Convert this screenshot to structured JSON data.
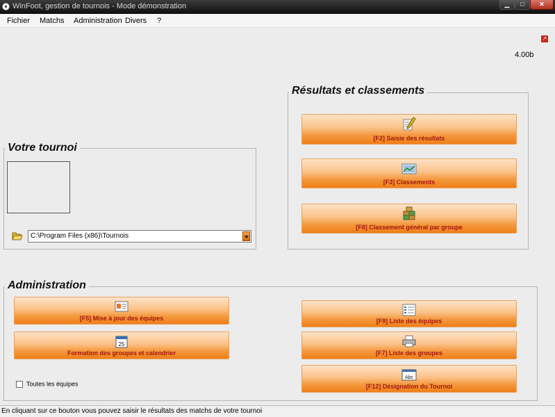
{
  "window": {
    "title": "WinFoot, gestion de tournois - Mode démonstration",
    "min_icon": "minimize-icon",
    "max_icon": "maximize-icon",
    "close_icon": "close-icon"
  },
  "menu": [
    {
      "label": "Fichier"
    },
    {
      "label": "Matchs"
    },
    {
      "label": "Administration"
    },
    {
      "label": "Divers"
    },
    {
      "label": "?"
    }
  ],
  "version": "4.00b",
  "results_section": {
    "title": "Résultats et classements",
    "buttons": [
      {
        "label": "[F2] Saisie des résultats",
        "icon": "edit-pencil-icon"
      },
      {
        "label": "[F3] Classements",
        "icon": "chart-image-icon"
      },
      {
        "label": "[F8] Classement général par groupe",
        "icon": "stacked-boxes-icon"
      }
    ]
  },
  "tournament_section": {
    "title": "Votre tournoi",
    "path": "C:\\Program Files (x86)\\Tournois"
  },
  "admin_section": {
    "title": "Administration",
    "buttons": [
      {
        "label": "[F5] Mise à jour des équipes",
        "icon": "team-card-icon"
      },
      {
        "label": "Formation des groupes et calendrier",
        "icon": "calendar-icon",
        "icon_text": "25"
      },
      {
        "label": "[F9] Liste des équipes",
        "icon": "list-icon"
      },
      {
        "label": "[F7] Liste des groupes",
        "icon": "printer-icon"
      },
      {
        "label": "[F12] Désignation du Tournoi",
        "icon": "abc-icon",
        "icon_text": "Abc"
      }
    ],
    "checkbox_label": "Toutes les équipes"
  },
  "status": "En cliquant sur ce bouton vous pouvez saisir le résultats des matchs de votre tournoi",
  "colors": {
    "button_gradient_start": "#fde3c8",
    "button_gradient_end": "#ef7f18",
    "button_text": "#a4170e"
  }
}
